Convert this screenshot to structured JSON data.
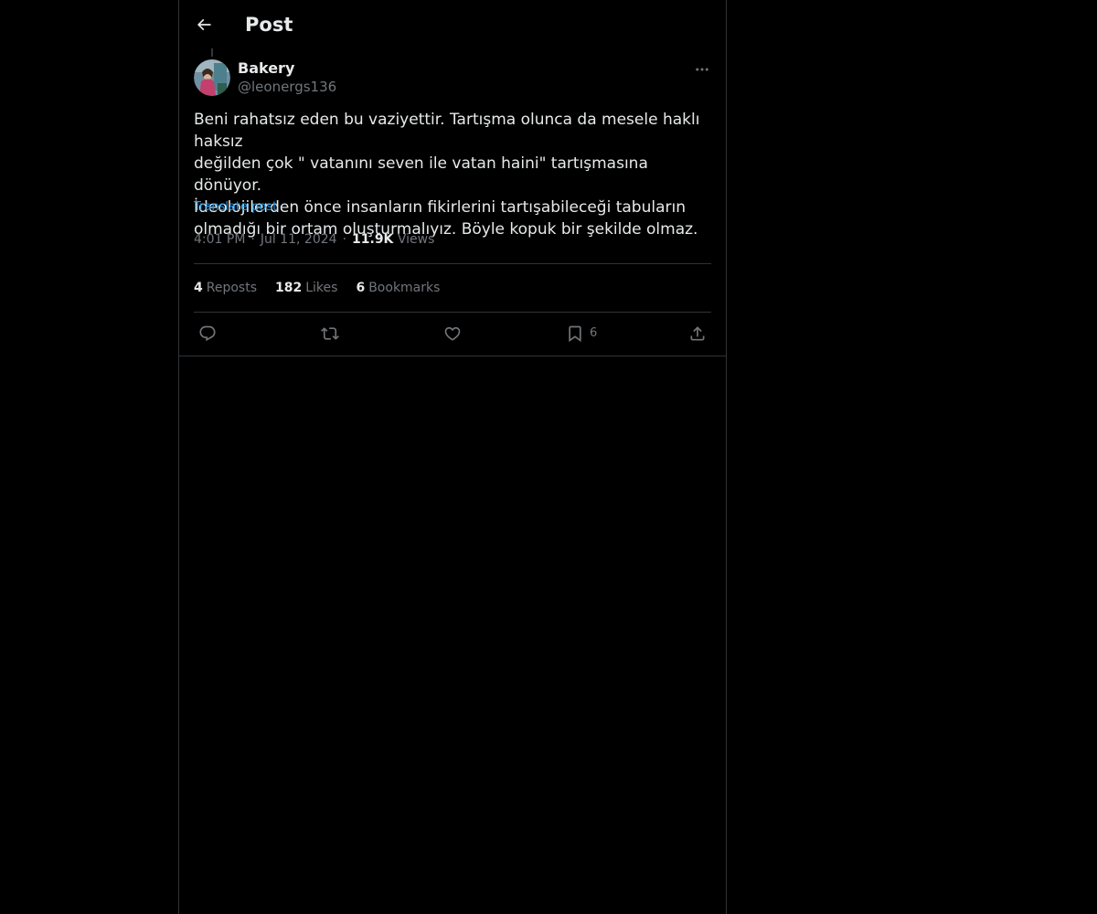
{
  "header": {
    "title": "Post",
    "back_icon": "arrow-left-icon"
  },
  "post": {
    "author_name": "Bakery",
    "author_handle": "@leonergs136",
    "text": "Beni rahatsız eden bu vaziyettir. Tartışma olunca da mesele haklı haksız\ndeğilden çok \" vatanını seven ile vatan haini\" tartışmasına dönüyor.\nİdeolojilerden önce insanların fikirlerini tartışabileceği tabuların\nolmadığı bir ortam oluşturmalıyız. Böyle kopuk bir şekilde olmaz.",
    "translate_label": "Translate post",
    "time": "4:01 PM",
    "date": "Jul 11, 2024",
    "views_count": "11.9K",
    "views_label": "Views",
    "separator": "·"
  },
  "stats": {
    "reposts_count": "4",
    "reposts_label": "Reposts",
    "likes_count": "182",
    "likes_label": "Likes",
    "bookmarks_count": "6",
    "bookmarks_label": "Bookmarks"
  },
  "actions": {
    "reply_icon": "reply-icon",
    "repost_icon": "repost-icon",
    "like_icon": "heart-icon",
    "bookmark_icon": "bookmark-icon",
    "bookmark_count": "6",
    "share_icon": "share-icon"
  },
  "colors": {
    "background": "#000000",
    "text_primary": "#e7e9ea",
    "text_secondary": "#71767b",
    "link": "#1d9bf0",
    "border": "#2f3336"
  }
}
